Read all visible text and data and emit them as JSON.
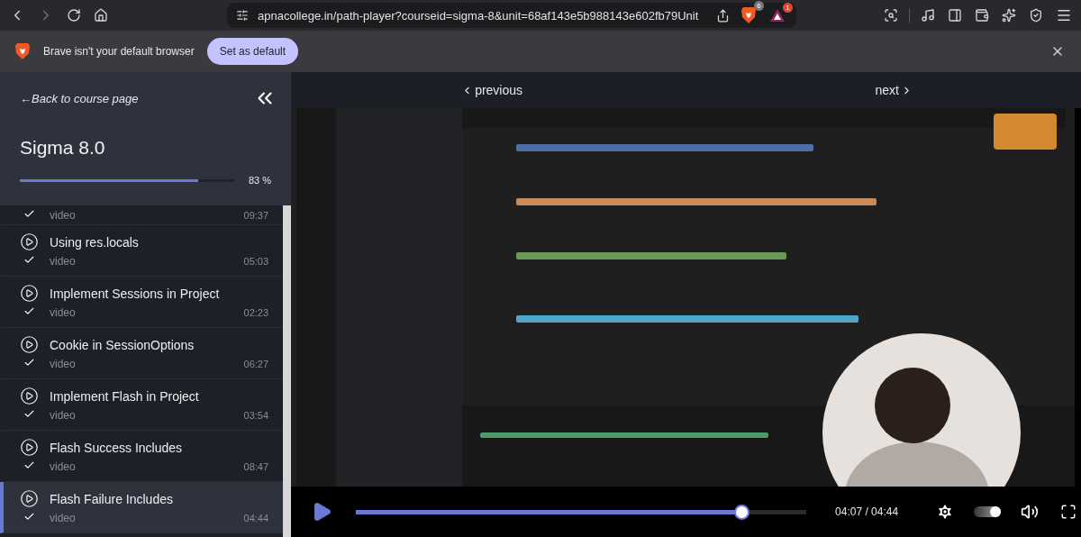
{
  "browser": {
    "url": "apnacollege.in/path-player?courseid=sigma-8&unit=68af143e5b988143e602fb79Unit",
    "shields_badge": "6",
    "rewards_badge": "1"
  },
  "infobar": {
    "message": "Brave isn't your default browser",
    "button": "Set as default"
  },
  "sidebar": {
    "back_arrow": "←",
    "back_link": "Back to course page",
    "course_title": "Sigma 8.0",
    "progress": {
      "level": 0.83,
      "reading": "83 %"
    },
    "lessons": [
      {
        "type": "video",
        "duration": "09:37",
        "completed": true,
        "selected": false
      },
      {
        "title": "Using res.locals",
        "type": "video",
        "duration": "05:03",
        "completed": true,
        "selected": false
      },
      {
        "title": "Implement Sessions in Project",
        "type": "video",
        "duration": "02:23",
        "completed": true,
        "selected": false
      },
      {
        "title": "Cookie in SessionOptions",
        "type": "video",
        "duration": "06:27",
        "completed": true,
        "selected": false
      },
      {
        "title": "Implement Flash in Project",
        "type": "video",
        "duration": "03:54",
        "completed": true,
        "selected": false
      },
      {
        "title": "Flash Success Includes",
        "type": "video",
        "duration": "08:47",
        "completed": true,
        "selected": false
      },
      {
        "title": "Flash Failure Includes",
        "type": "video",
        "duration": "04:44",
        "completed": true,
        "selected": true
      }
    ]
  },
  "player": {
    "previous": "previous",
    "next": "next",
    "playing": false,
    "seek": {
      "level": 0.845
    },
    "time": "04:07 / 04:44",
    "autoplay": true
  }
}
